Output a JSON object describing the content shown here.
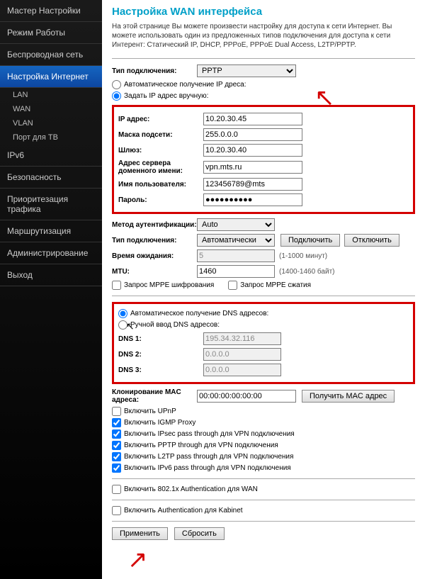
{
  "sidebar": {
    "items": [
      {
        "label": "Мастер Настройки"
      },
      {
        "label": "Режим Работы"
      },
      {
        "label": "Беспроводная сеть"
      },
      {
        "label": "Настройка Интернет"
      },
      {
        "label": "IPv6"
      },
      {
        "label": "Безопасность"
      },
      {
        "label": "Приоритезация трафика"
      },
      {
        "label": "Маршрутизация"
      },
      {
        "label": "Администрирование"
      },
      {
        "label": "Выход"
      }
    ],
    "subs": [
      {
        "label": "LAN"
      },
      {
        "label": "WAN"
      },
      {
        "label": "VLAN"
      },
      {
        "label": "Порт для ТВ"
      }
    ]
  },
  "page": {
    "title": "Настройка WAN интерфейса",
    "desc": "На этой странице Вы можете произвести настройку для доступа к сети Интернет. Вы можете использовать один из предложенных типов подключения для доступа к сети Интерент: Статический IP, DHCP, PPPoE, PPPoE Dual Access, L2TP/PPTP."
  },
  "form": {
    "connType": {
      "label": "Тип подключения:",
      "value": "PPTP"
    },
    "ipAuto": {
      "label": "Автоматическое получение IP дреса:"
    },
    "ipManual": {
      "label": "Задать IP адрес вручную:"
    },
    "ip": {
      "label": "IP адрес:",
      "value": "10.20.30.45"
    },
    "mask": {
      "label": "Маска подсети:",
      "value": "255.0.0.0"
    },
    "gw": {
      "label": "Шлюз:",
      "value": "10.20.30.40"
    },
    "server": {
      "label": "Адрес сервера доменного имени:",
      "value": "vpn.mts.ru"
    },
    "user": {
      "label": "Имя пользователя:",
      "value": "123456789@mts"
    },
    "pass": {
      "label": "Пароль:",
      "value": "●●●●●●●●●●"
    },
    "auth": {
      "label": "Метод аутентификации:",
      "value": "Auto"
    },
    "ctype": {
      "label": "Тип подключения:",
      "value": "Автоматически"
    },
    "btnConnect": "Подключить",
    "btnDisconnect": "Отключить",
    "wait": {
      "label": "Время ожидания:",
      "value": "5",
      "hint": "(1-1000 минут)"
    },
    "mtu": {
      "label": "MTU:",
      "value": "1460",
      "hint": "(1400-1460 байт)"
    },
    "mppeEnc": {
      "label": "Запрос MPPE шифрования"
    },
    "mppeComp": {
      "label": "Запрос MPPE сжатия"
    },
    "dnsAuto": {
      "label": "Автоматическое получение DNS адресов:"
    },
    "dnsManual": {
      "label": "Ручной ввод DNS адресов:"
    },
    "dns1": {
      "label": "DNS 1:",
      "value": "195.34.32.116"
    },
    "dns2": {
      "label": "DNS 2:",
      "value": "0.0.0.0"
    },
    "dns3": {
      "label": "DNS 3:",
      "value": "0.0.0.0"
    },
    "macClone": {
      "label": "Клонирование MAC адреса:",
      "value": "00:00:00:00:00:00"
    },
    "btnGetMac": "Получить MAC адрес",
    "upnp": {
      "label": "Включить UPnP"
    },
    "igmp": {
      "label": "Включить IGMP Proxy"
    },
    "ipsec": {
      "label": "Включить IPsec pass through для VPN подключения"
    },
    "pptp": {
      "label": "Включить PPTP through для VPN подключения"
    },
    "l2tp": {
      "label": "Включить L2TP pass through для VPN подключения"
    },
    "ipv6": {
      "label": "Включить IPv6 pass through для VPN подключения"
    },
    "dot1x": {
      "label": "Включить 802.1x Authentication для WAN"
    },
    "kab": {
      "label": "Включить Authentication для Kabinet"
    },
    "btnApply": "Применить",
    "btnReset": "Сбросить"
  }
}
